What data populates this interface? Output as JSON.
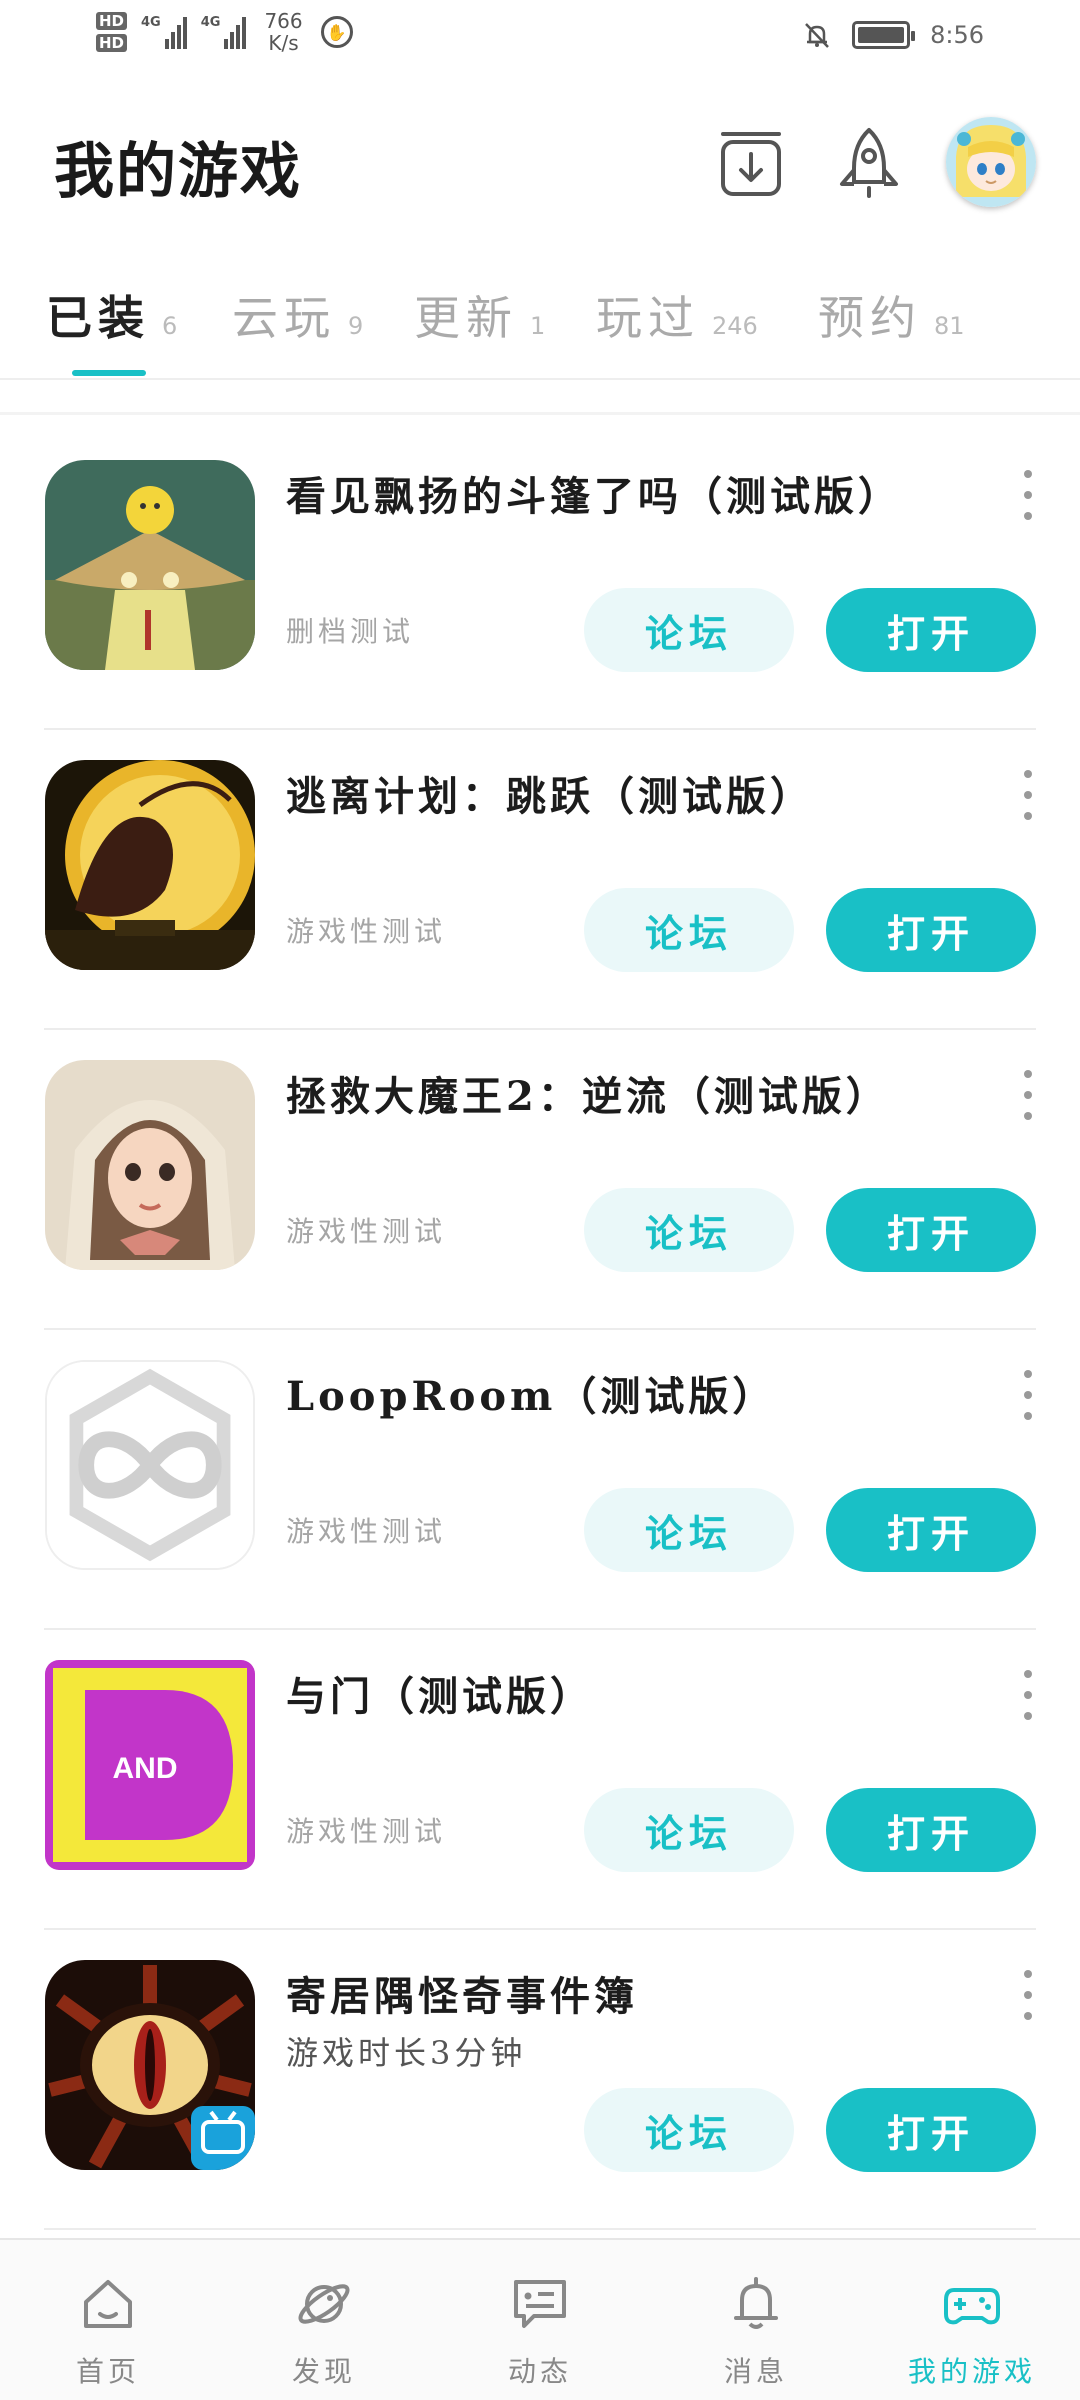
{
  "status_bar": {
    "hd1": "HD",
    "hd2": "HD",
    "net1": "4G",
    "net2": "4G",
    "speed_value": "766",
    "speed_unit": "K/s",
    "time": "8:56"
  },
  "header": {
    "title": "我的游戏"
  },
  "tabs": [
    {
      "label": "已装",
      "count": "6"
    },
    {
      "label": "云玩",
      "count": "9"
    },
    {
      "label": "更新",
      "count": "1"
    },
    {
      "label": "玩过",
      "count": "246"
    },
    {
      "label": "预约",
      "count": "81"
    }
  ],
  "games": [
    {
      "title": "看见飘扬的斗篷了吗（测试版）",
      "subtitle": "删档测试",
      "forum_label": "论坛",
      "open_label": "打开"
    },
    {
      "title": "逃离计划：跳跃（测试版）",
      "subtitle": "游戏性测试",
      "forum_label": "论坛",
      "open_label": "打开"
    },
    {
      "title": "拯救大魔王2：逆流（测试版）",
      "subtitle": "游戏性测试",
      "forum_label": "论坛",
      "open_label": "打开"
    },
    {
      "title": "LoopRoom（测试版）",
      "subtitle": "游戏性测试",
      "forum_label": "论坛",
      "open_label": "打开"
    },
    {
      "title": "与门（测试版）",
      "subtitle": "游戏性测试",
      "forum_label": "论坛",
      "open_label": "打开",
      "icon_text": "AND"
    },
    {
      "title": "寄居隅怪奇事件簿",
      "subtitle": "游戏时长3分钟",
      "forum_label": "论坛",
      "open_label": "打开"
    }
  ],
  "bottom_nav": [
    {
      "label": "首页",
      "icon": "home-icon"
    },
    {
      "label": "发现",
      "icon": "planet-icon"
    },
    {
      "label": "动态",
      "icon": "chat-icon"
    },
    {
      "label": "消息",
      "icon": "bell-icon"
    },
    {
      "label": "我的游戏",
      "icon": "gamepad-icon"
    }
  ],
  "colors": {
    "accent": "#19c0c6",
    "forum_bg": "#eaf8f9"
  }
}
